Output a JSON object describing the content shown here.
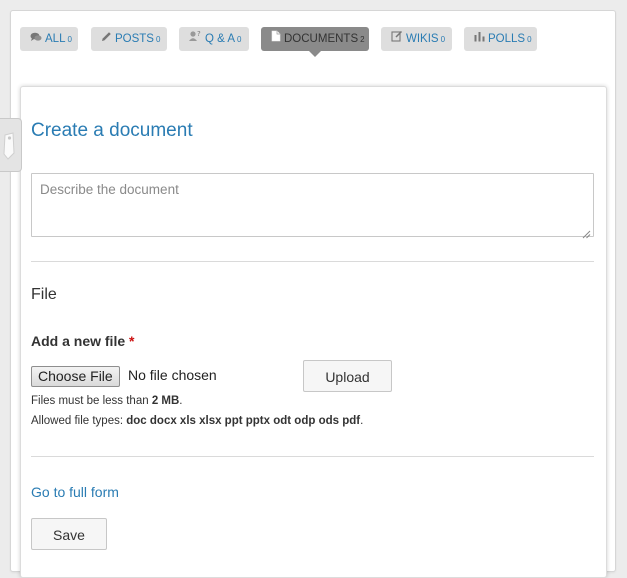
{
  "tabs": [
    {
      "label": "ALL",
      "count": "0",
      "icon": "chat-bubbles-icon"
    },
    {
      "label": "POSTS",
      "count": "0",
      "icon": "pencil-icon"
    },
    {
      "label": "Q & A",
      "count": "0",
      "icon": "question-people-icon"
    },
    {
      "label": "DOCUMENTS",
      "count": "2",
      "icon": "document-icon",
      "active": true
    },
    {
      "label": "WIKIS",
      "count": "0",
      "icon": "edit-page-icon"
    },
    {
      "label": "POLLS",
      "count": "0",
      "icon": "bar-chart-icon"
    }
  ],
  "form": {
    "title": "Create a document",
    "description_placeholder": "Describe the document",
    "file_section": "File",
    "add_file_label": "Add a new file",
    "required_marker": "*",
    "choose_file_label": "Choose File",
    "no_file_text": "No file chosen",
    "upload_label": "Upload",
    "size_prefix": "Files must be less than ",
    "size_value": "2 MB",
    "size_suffix": ".",
    "types_prefix": "Allowed file types: ",
    "types_value": "doc docx xls xlsx ppt pptx odt odp ods pdf",
    "types_suffix": ".",
    "full_form_link": "Go to full form",
    "save_label": "Save"
  },
  "colors": {
    "link": "#2a7cb3",
    "required": "#cc1111",
    "active_tab": "#8a8a8a",
    "tab": "#dedede"
  }
}
